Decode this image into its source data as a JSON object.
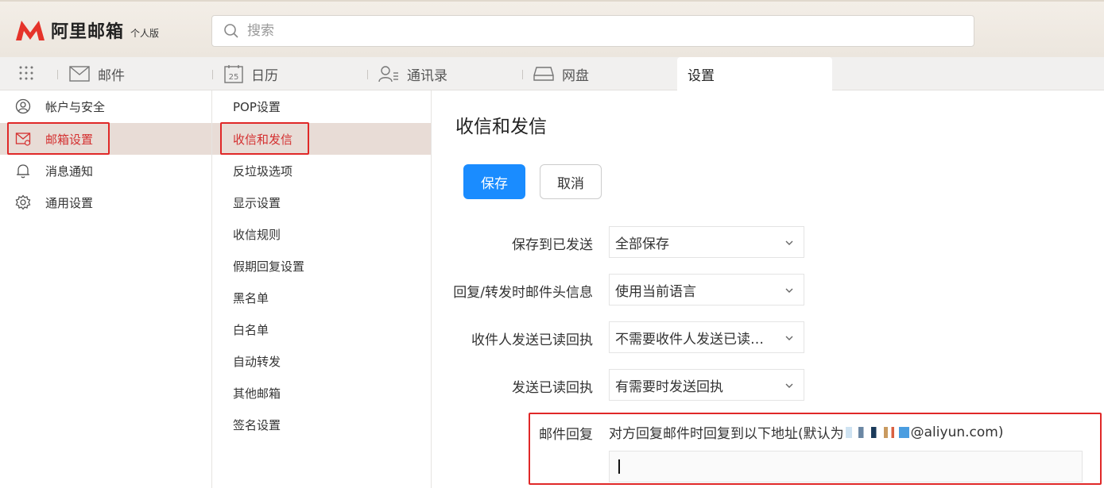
{
  "header": {
    "logo_name": "阿里邮箱",
    "edition": "个人版",
    "search_placeholder": "搜索"
  },
  "nav": {
    "tabs": [
      {
        "label": "邮件",
        "icon": "mail-icon"
      },
      {
        "label": "日历",
        "icon": "calendar-icon",
        "icon_text": "25"
      },
      {
        "label": "通讯录",
        "icon": "contacts-icon"
      },
      {
        "label": "网盘",
        "icon": "drive-icon"
      },
      {
        "label": "设置",
        "active": true
      }
    ]
  },
  "sidebar": {
    "items": [
      {
        "label": "帐户与安全",
        "icon": "user-icon"
      },
      {
        "label": "邮箱设置",
        "icon": "mail-settings-icon",
        "active": true
      },
      {
        "label": "消息通知",
        "icon": "bell-icon"
      },
      {
        "label": "通用设置",
        "icon": "gear-icon"
      }
    ]
  },
  "subnav": {
    "items": [
      {
        "label": "POP设置"
      },
      {
        "label": "收信和发信",
        "active": true
      },
      {
        "label": "反垃圾选项"
      },
      {
        "label": "显示设置"
      },
      {
        "label": "收信规则"
      },
      {
        "label": "假期回复设置"
      },
      {
        "label": "黑名单"
      },
      {
        "label": "白名单"
      },
      {
        "label": "自动转发"
      },
      {
        "label": "其他邮箱"
      },
      {
        "label": "签名设置"
      }
    ]
  },
  "main": {
    "title": "收信和发信",
    "save_label": "保存",
    "cancel_label": "取消",
    "settings": [
      {
        "label": "保存到已发送",
        "value": "全部保存"
      },
      {
        "label": "回复/转发时邮件头信息",
        "value": "使用当前语言"
      },
      {
        "label": "收件人发送已读回执",
        "value": "不需要收件人发送已读回执"
      },
      {
        "label": "发送已读回执",
        "value": "有需要时发送回执"
      }
    ],
    "reply": {
      "label": "邮件回复",
      "desc_prefix": "对方回复邮件时回复到以下地址(默认为",
      "desc_suffix": "@aliyun.com)",
      "value": ""
    }
  },
  "colors": {
    "accent_blue": "#1a8cff",
    "highlight_red": "#e02828",
    "active_text": "#d43030",
    "active_bg": "#e8dcd6"
  }
}
